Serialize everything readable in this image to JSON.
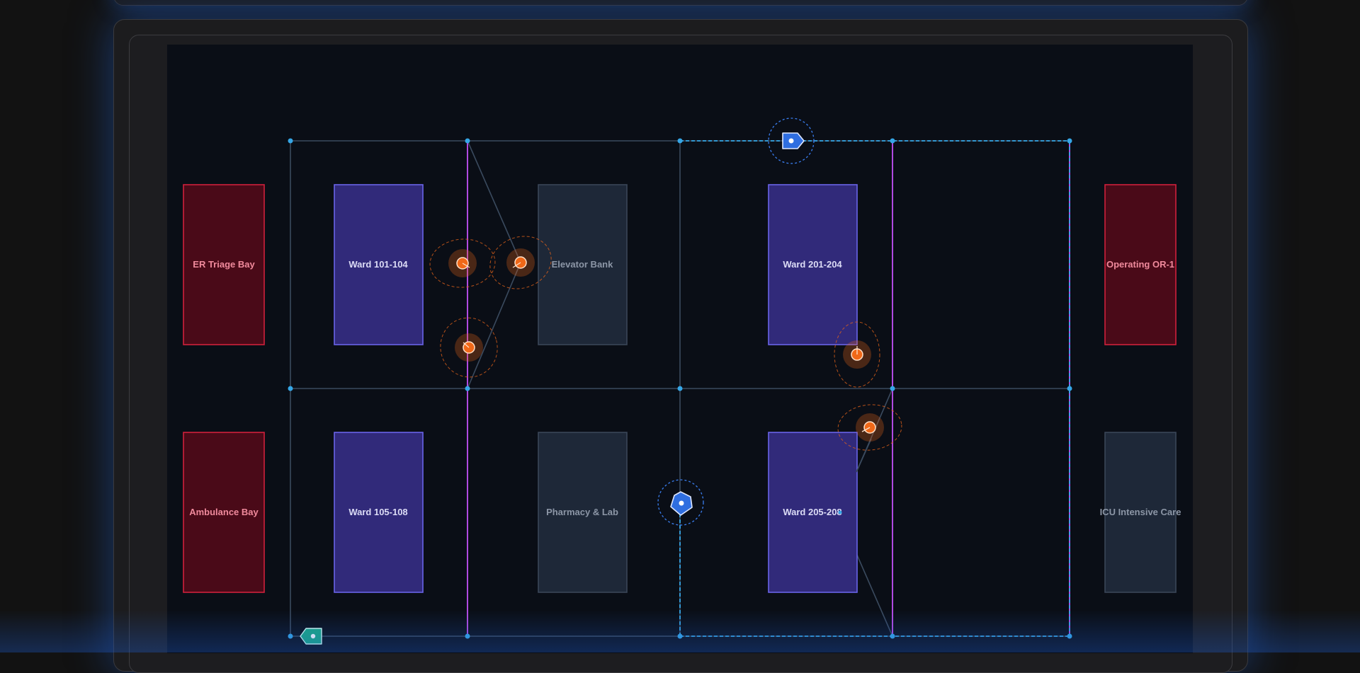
{
  "rooms": [
    {
      "key": "er-triage-bay",
      "label": "ER Triage Bay",
      "kind": "emergency"
    },
    {
      "key": "ward-101-104",
      "label": "Ward 101-104",
      "kind": "ward"
    },
    {
      "key": "elevator-bank",
      "label": "Elevator Bank",
      "kind": "service"
    },
    {
      "key": "ward-201-204",
      "label": "Ward 201-204",
      "kind": "ward"
    },
    {
      "key": "operating-or-1",
      "label": "Operating OR-1",
      "kind": "emergency"
    },
    {
      "key": "ambulance-bay",
      "label": "Ambulance Bay",
      "kind": "emergency"
    },
    {
      "key": "ward-105-108",
      "label": "Ward 105-108",
      "kind": "ward"
    },
    {
      "key": "pharmacy-lab",
      "label": "Pharmacy & Lab",
      "kind": "service"
    },
    {
      "key": "ward-205-208",
      "label": "Ward 205-208",
      "kind": "ward"
    },
    {
      "key": "icu-intensive-care",
      "label": "ICU Intensive Care",
      "kind": "service"
    }
  ],
  "markers": {
    "alerts": 5,
    "staff_tags": 2,
    "equipment_tags": 1
  },
  "colors": {
    "emergency_fill": "#4a0a18",
    "emergency_stroke": "#d0203c",
    "emergency_text": "#f08a9c",
    "ward_fill": "#312a7a",
    "ward_stroke": "#6a64e8",
    "ward_text": "#dcdcf6",
    "service_fill": "#1e2838",
    "service_stroke": "#3a4658",
    "service_text": "#8c96a6",
    "corridor": "#3a4a5e",
    "junction": "#35a6e6",
    "route": "#35a6e6",
    "wall": "#b04ae0",
    "alert": "#f06818",
    "staff_tag": "#3a7ef0",
    "equipment_tag": "#1aa884"
  },
  "icons": {
    "alert": "alert-pin-icon",
    "staff": "staff-tag-icon",
    "equipment": "equipment-tag-icon"
  }
}
